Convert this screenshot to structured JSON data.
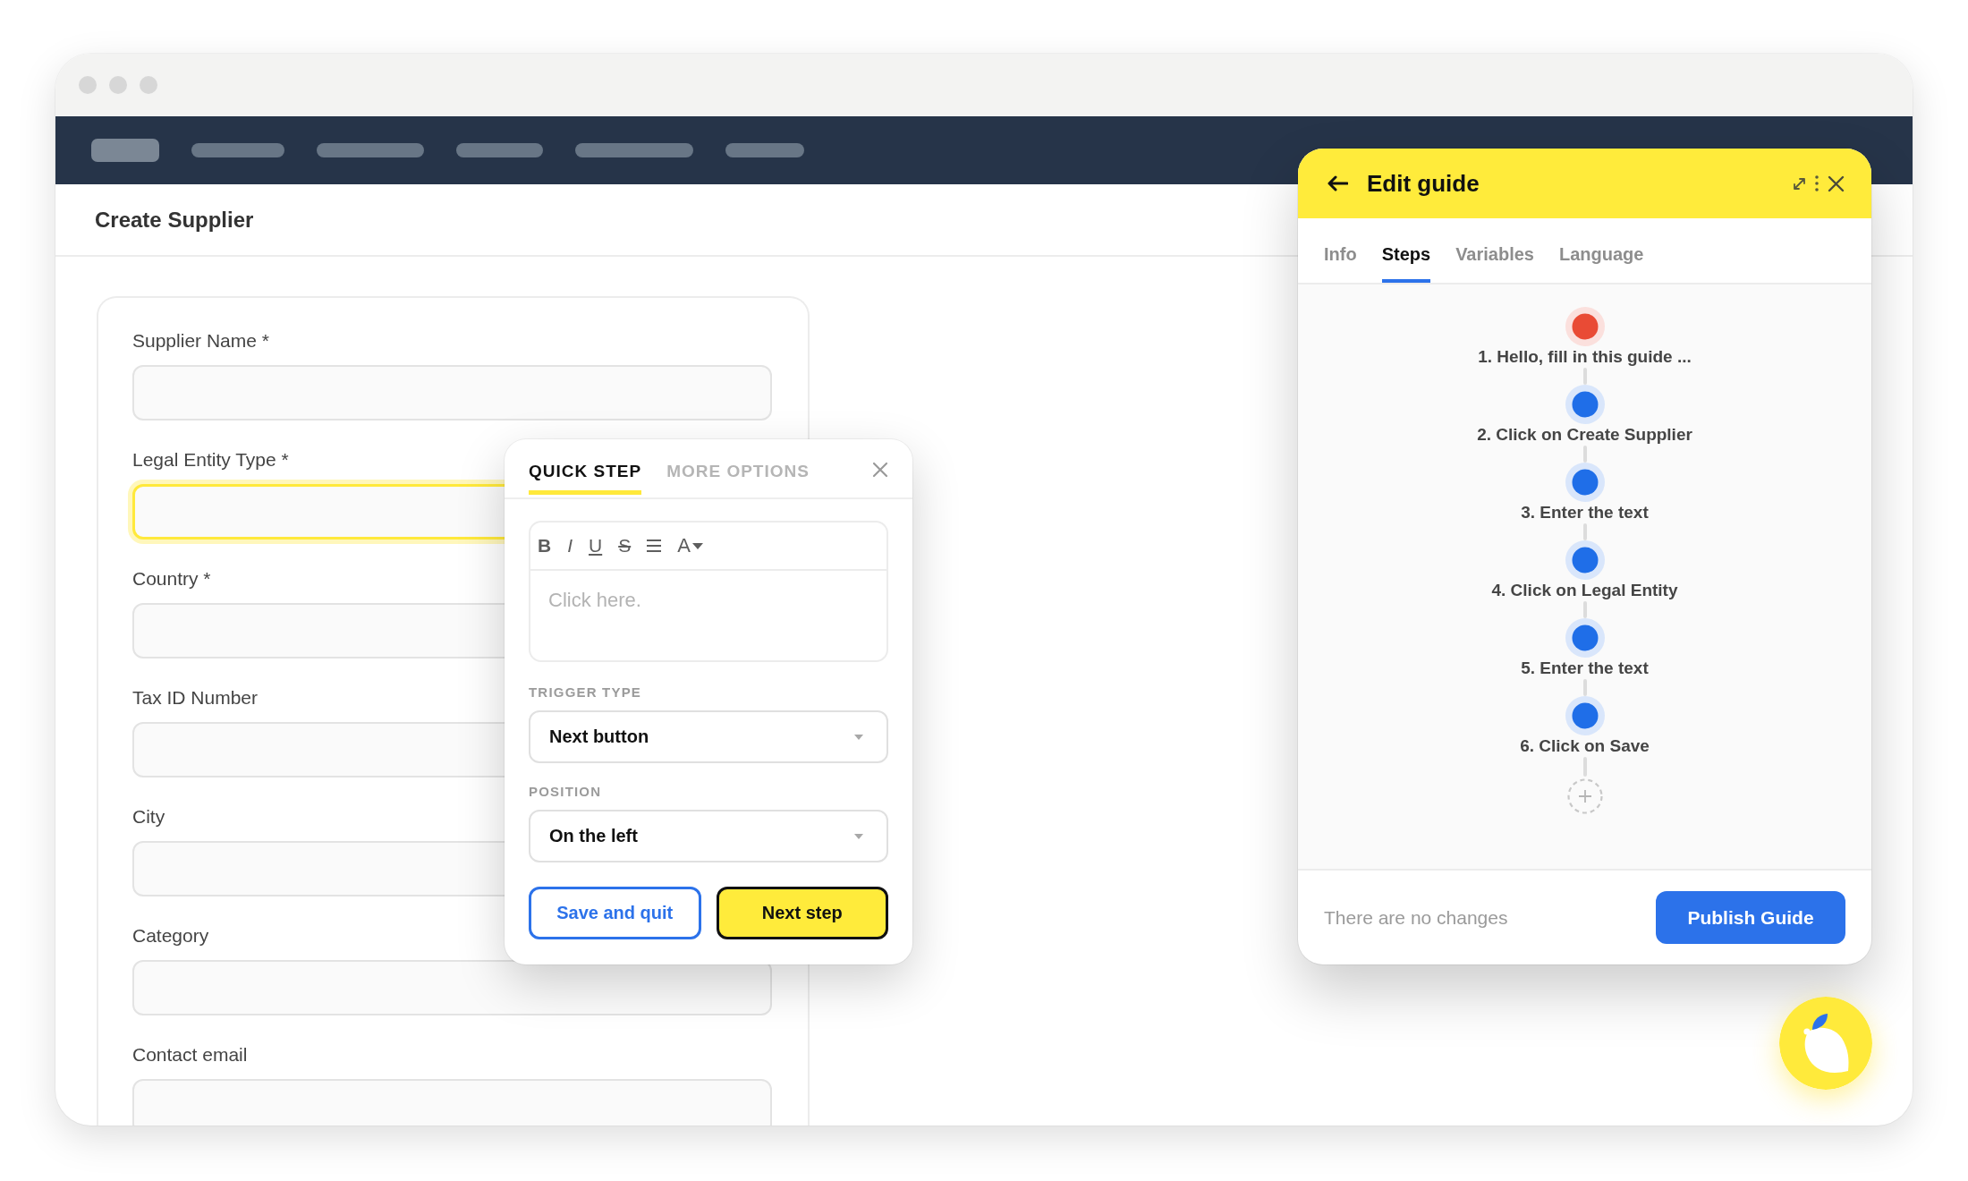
{
  "page": {
    "title": "Create Supplier"
  },
  "form": {
    "fields": [
      {
        "label": "Supplier Name *",
        "highlighted": false
      },
      {
        "label": "Legal Entity Type *",
        "highlighted": true
      },
      {
        "label": "Country *",
        "highlighted": false
      },
      {
        "label": "Tax ID Number",
        "highlighted": false
      },
      {
        "label": "City",
        "highlighted": false
      },
      {
        "label": "Category",
        "highlighted": false
      },
      {
        "label": "Contact email",
        "highlighted": false
      }
    ]
  },
  "quick_step": {
    "tabs": [
      {
        "label": "QUICK STEP",
        "selected": true
      },
      {
        "label": "MORE OPTIONS",
        "selected": false
      }
    ],
    "toolbar": [
      {
        "kind": "bold",
        "label": "B"
      },
      {
        "kind": "italic",
        "label": "I"
      },
      {
        "kind": "underline",
        "label": "U"
      },
      {
        "kind": "strike",
        "label": "S"
      },
      {
        "kind": "list"
      },
      {
        "kind": "font",
        "label": "A"
      }
    ],
    "editor": {
      "placeholder": "Click here."
    },
    "selects": [
      {
        "label": "TRIGGER TYPE",
        "value": "Next button"
      },
      {
        "label": "POSITION",
        "value": "On the left"
      }
    ],
    "buttons": [
      {
        "kind": "secondary",
        "label": "Save and quit"
      },
      {
        "kind": "primary",
        "label": "Next step"
      }
    ]
  },
  "guide_panel": {
    "title": "Edit guide",
    "tabs": [
      {
        "label": "Info",
        "selected": false
      },
      {
        "label": "Steps",
        "selected": true
      },
      {
        "label": "Variables",
        "selected": false
      },
      {
        "label": "Language",
        "selected": false
      }
    ],
    "steps": [
      {
        "label": "1. Hello, fill in this guide ...",
        "color": "#e94b35"
      },
      {
        "label": "2. Click on Create Supplier",
        "color": "#1f6ee8"
      },
      {
        "label": "3. Enter the text",
        "color": "#1f6ee8"
      },
      {
        "label": "4. Click on Legal Entity",
        "color": "#1f6ee8"
      },
      {
        "label": "5. Enter the text",
        "color": "#1f6ee8"
      },
      {
        "label": "6. Click on Save",
        "color": "#1f6ee8"
      }
    ],
    "status": "There are no changes",
    "publish_button": {
      "label": "Publish Guide"
    }
  }
}
